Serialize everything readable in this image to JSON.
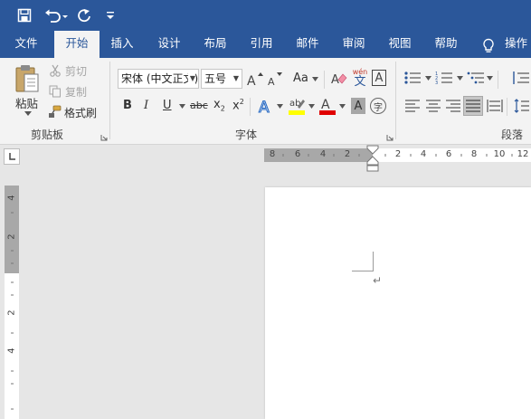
{
  "quick_access": {
    "save_icon": "save-icon",
    "undo_icon": "undo-icon",
    "redo_icon": "redo-icon",
    "customize_icon": "customize-qat-icon"
  },
  "tabs": {
    "file": "文件",
    "home": "开始",
    "insert": "插入",
    "design": "设计",
    "layout": "布局",
    "references": "引用",
    "mailings": "邮件",
    "review": "审阅",
    "view": "视图",
    "help": "帮助",
    "tell_me": "操作说"
  },
  "clipboard": {
    "paste": "粘贴",
    "cut": "剪切",
    "copy": "复制",
    "format_painter": "格式刷",
    "group_label": "剪贴板"
  },
  "font": {
    "font_name": "宋体 (中文正文)",
    "font_size": "五号",
    "case_label": "Aa",
    "bold": "B",
    "italic": "I",
    "underline": "U",
    "strikethrough": "abc",
    "subscript": "x",
    "superscript": "x",
    "group_label": "字体",
    "phonetic_top": "wén",
    "phonetic_bottom": "文",
    "border_char": "A",
    "shade_char": "A",
    "enclose_char": "字"
  },
  "paragraph": {
    "group_label": "段落"
  },
  "horizontal_ruler": {
    "left_numbers": [
      "8",
      "6",
      "4",
      "2"
    ],
    "right_numbers": [
      "2",
      "4",
      "6",
      "8",
      "10",
      "12"
    ]
  },
  "vertical_ruler": {
    "numbers": [
      "4",
      "2",
      "2",
      "4"
    ]
  },
  "document": {
    "paragraph_mark": "↵"
  },
  "colors": {
    "title_bar": "#2b579a",
    "ribbon": "#f3f3f3",
    "highlight_yellow": "#ffff00",
    "font_red": "#e00000"
  }
}
